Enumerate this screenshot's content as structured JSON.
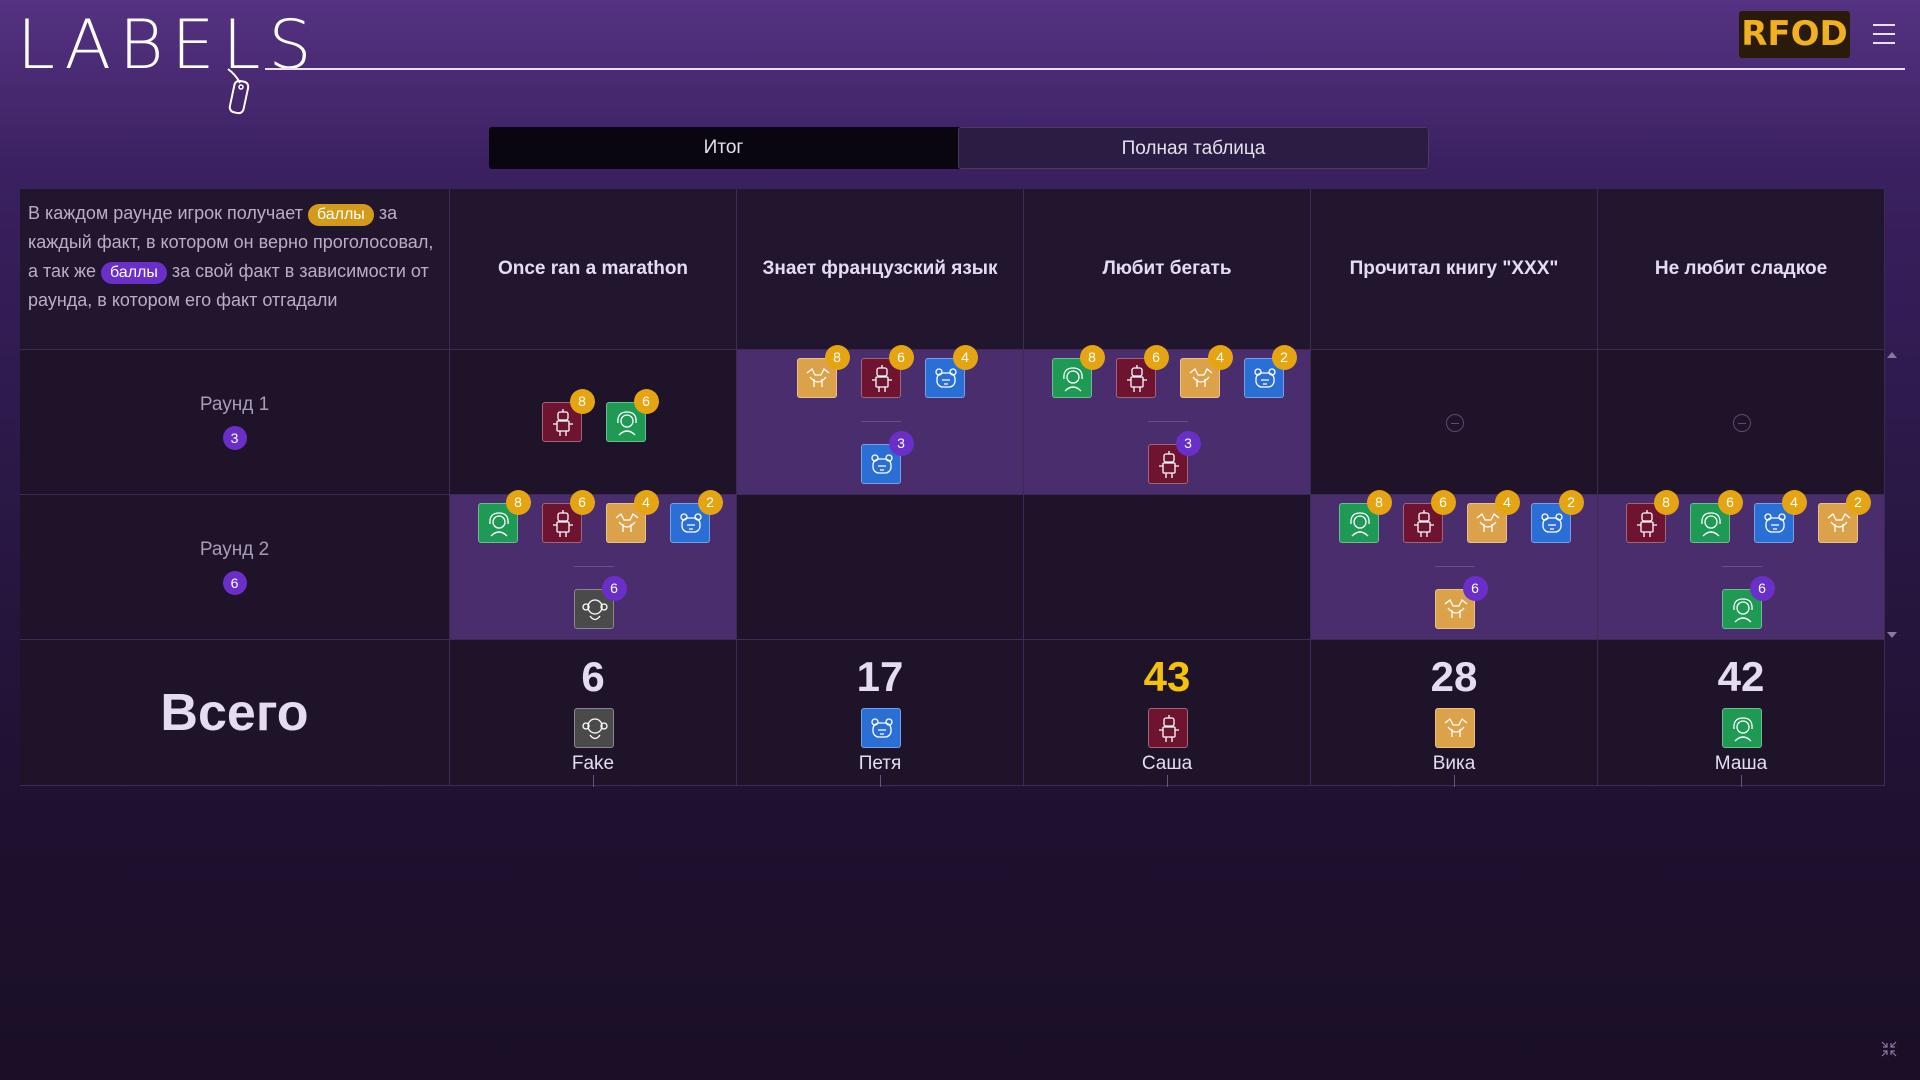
{
  "logo": {
    "text": "LABELS"
  },
  "header": {
    "brand": "RFOD"
  },
  "tabs": [
    {
      "label": "Итог"
    },
    {
      "label": "Полная таблица"
    }
  ],
  "intro": {
    "part1": "В каждом раунде игрок получает ",
    "pill1": "баллы",
    "part2": " за каждый факт, в котором он верно проголосовал, а так же ",
    "pill2": "баллы",
    "part3": " за свой факт в зависимости от раунда, в котором его факт отгадали"
  },
  "columns": [
    {
      "fact": "Once ran a marathon"
    },
    {
      "fact": "Знает французский язык"
    },
    {
      "fact": "Любит бегать"
    },
    {
      "fact": "Прочитал книгу \"XXX\""
    },
    {
      "fact": "Не любит сладкое"
    }
  ],
  "rounds": [
    {
      "label": "Раунд 1",
      "points": "3"
    },
    {
      "label": "Раунд 2",
      "points": "6"
    }
  ],
  "cells": {
    "r0": [
      {
        "votes": [
          {
            "color": "red",
            "icon": "robot-icon",
            "pts": "8"
          },
          {
            "color": "green",
            "icon": "girl-icon",
            "pts": "6"
          }
        ],
        "guessed": null
      },
      {
        "votes": [
          {
            "color": "orange",
            "icon": "dog-icon",
            "pts": "8"
          },
          {
            "color": "red",
            "icon": "robot-icon",
            "pts": "6"
          },
          {
            "color": "blue",
            "icon": "bear-icon",
            "pts": "4"
          }
        ],
        "guessed": {
          "color": "blue",
          "icon": "bear-icon",
          "pts": "3"
        }
      },
      {
        "votes": [
          {
            "color": "green",
            "icon": "girl-icon",
            "pts": "8"
          },
          {
            "color": "red",
            "icon": "robot-icon",
            "pts": "6"
          },
          {
            "color": "orange",
            "icon": "dog-icon",
            "pts": "4"
          },
          {
            "color": "blue",
            "icon": "bear-icon",
            "pts": "2"
          }
        ],
        "guessed": {
          "color": "red",
          "icon": "robot-icon",
          "pts": "3"
        }
      },
      {
        "votes": [],
        "guessed": null
      },
      {
        "votes": [],
        "guessed": null
      }
    ],
    "r1": [
      {
        "votes": [
          {
            "color": "green",
            "icon": "girl-icon",
            "pts": "8"
          },
          {
            "color": "red",
            "icon": "robot-icon",
            "pts": "6"
          },
          {
            "color": "orange",
            "icon": "dog-icon",
            "pts": "4"
          },
          {
            "color": "blue",
            "icon": "bear-icon",
            "pts": "2"
          }
        ],
        "guessed": {
          "color": "gray",
          "icon": "monkey-icon",
          "pts": "6"
        }
      },
      {
        "votes": [],
        "guessed": null
      },
      {
        "votes": [],
        "guessed": null
      },
      {
        "votes": [
          {
            "color": "green",
            "icon": "girl-icon",
            "pts": "8"
          },
          {
            "color": "red",
            "icon": "robot-icon",
            "pts": "6"
          },
          {
            "color": "orange",
            "icon": "dog-icon",
            "pts": "4"
          },
          {
            "color": "blue",
            "icon": "bear-icon",
            "pts": "2"
          }
        ],
        "guessed": {
          "color": "orange",
          "icon": "dog-icon",
          "pts": "6"
        }
      },
      {
        "votes": [
          {
            "color": "red",
            "icon": "robot-icon",
            "pts": "8"
          },
          {
            "color": "green",
            "icon": "girl-icon",
            "pts": "6"
          },
          {
            "color": "blue",
            "icon": "bear-icon",
            "pts": "4"
          },
          {
            "color": "orange",
            "icon": "dog-icon",
            "pts": "2"
          }
        ],
        "guessed": {
          "color": "green",
          "icon": "girl-icon",
          "pts": "6"
        }
      }
    ]
  },
  "totals": {
    "label": "Всего",
    "players": [
      {
        "score": "6",
        "name": "Fake",
        "color": "gray",
        "icon": "monkey-icon",
        "winner": false
      },
      {
        "score": "17",
        "name": "Петя",
        "color": "blue",
        "icon": "bear-icon",
        "winner": false
      },
      {
        "score": "43",
        "name": "Саша",
        "color": "red",
        "icon": "robot-icon",
        "winner": true
      },
      {
        "score": "28",
        "name": "Вика",
        "color": "orange",
        "icon": "dog-icon",
        "winner": false
      },
      {
        "score": "42",
        "name": "Маша",
        "color": "green",
        "icon": "girl-icon",
        "winner": false
      }
    ]
  },
  "colors": {
    "accent": "#e5a512",
    "purple": "#6a2fc8",
    "win": "#f4c20a"
  }
}
